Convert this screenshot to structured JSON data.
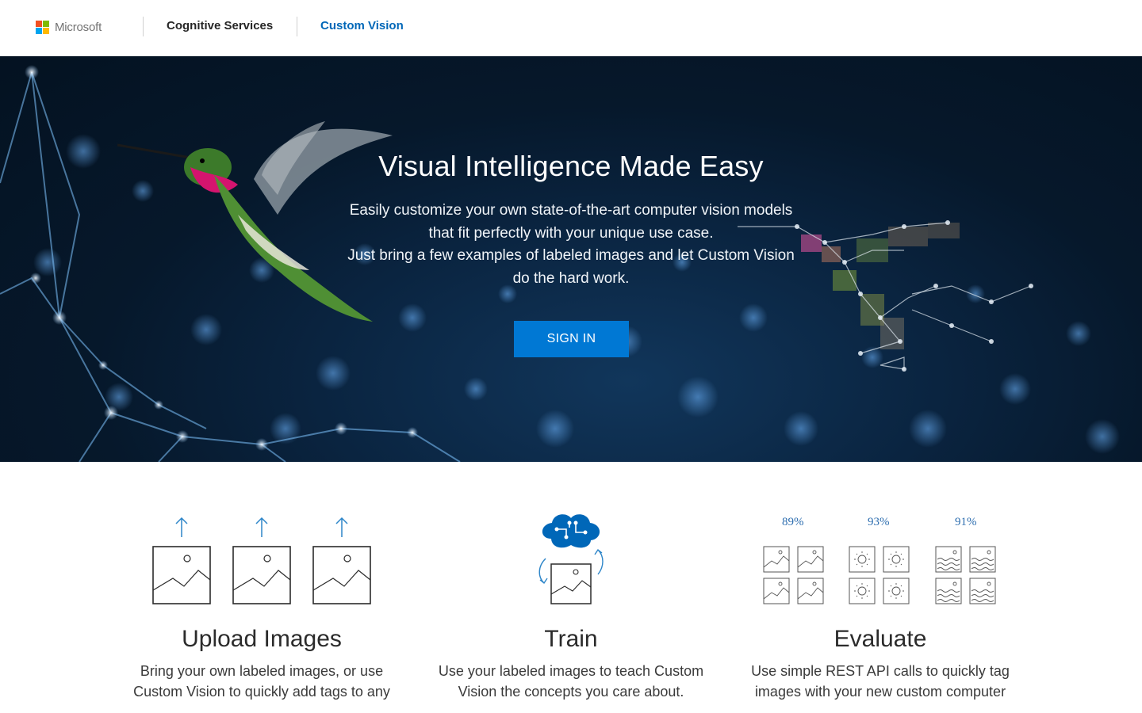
{
  "header": {
    "brand": "Microsoft",
    "nav": [
      {
        "label": "Cognitive Services"
      },
      {
        "label": "Custom Vision"
      }
    ],
    "colors": {
      "red": "#f25022",
      "green": "#7fba00",
      "blue": "#00a4ef",
      "yellow": "#ffb900",
      "active": "#0067b8"
    }
  },
  "hero": {
    "title": "Visual Intelligence Made Easy",
    "subtitle_lines": [
      "Easily customize your own state-of-the-art computer vision models",
      "that fit perfectly with your unique use case.",
      "Just bring a few examples of labeled images and let Custom Vision",
      "do the hard work."
    ],
    "cta_label": "SIGN IN",
    "cta_color": "#0078d4"
  },
  "features": [
    {
      "icon": "upload-images-icon",
      "title": "Upload Images",
      "text_lines": [
        "Bring your own labeled images, or use",
        "Custom Vision to quickly add tags to any"
      ]
    },
    {
      "icon": "train-brain-icon",
      "title": "Train",
      "text_lines": [
        "Use your labeled images to teach Custom",
        "Vision the concepts you care about."
      ]
    },
    {
      "icon": "evaluate-grid-icon",
      "title": "Evaluate",
      "text_lines": [
        "Use simple REST API calls to quickly tag",
        "images with your new custom computer"
      ],
      "scores": [
        "89%",
        "93%",
        "91%"
      ]
    }
  ]
}
